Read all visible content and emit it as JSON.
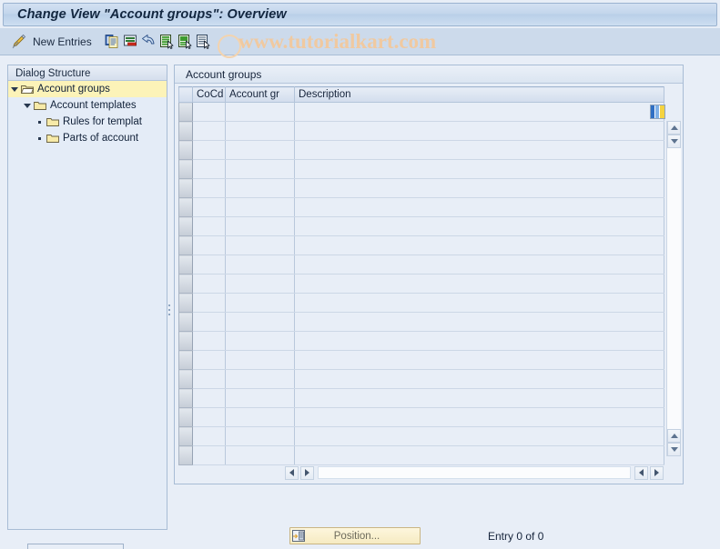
{
  "window": {
    "title": "Change View \"Account groups\": Overview"
  },
  "toolbar": {
    "edit_icon": "pencil-icon",
    "new_entries_label": "New Entries",
    "buttons": [
      {
        "name": "copy-as-button",
        "icon": "copy-document-icon"
      },
      {
        "name": "delete-button",
        "icon": "delete-document-icon"
      },
      {
        "name": "undo-button",
        "icon": "undo-arrow-icon"
      },
      {
        "name": "select-all-button",
        "icon": "document-select-icon"
      },
      {
        "name": "deselect-all-button",
        "icon": "document-deselect-icon"
      },
      {
        "name": "variant-button",
        "icon": "document-list-icon"
      }
    ]
  },
  "watermark": {
    "text": "www.tutorialkart.com"
  },
  "dialog_structure": {
    "header": "Dialog Structure",
    "items": [
      {
        "label": "Account groups",
        "level": 0,
        "expanded": true,
        "selected": true,
        "icon": "open-folder-icon"
      },
      {
        "label": "Account templates",
        "level": 1,
        "expanded": true,
        "selected": false,
        "icon": "folder-icon"
      },
      {
        "label": "Rules for templat",
        "level": 2,
        "expanded": false,
        "selected": false,
        "icon": "folder-icon"
      },
      {
        "label": "Parts of account",
        "level": 2,
        "expanded": false,
        "selected": false,
        "icon": "folder-icon"
      }
    ]
  },
  "main": {
    "section_title": "Account groups",
    "table": {
      "columns": [
        "CoCd",
        "Account gr",
        "Description"
      ],
      "rows": [],
      "empty_row_count": 19,
      "config_icon": "table-settings-icon"
    },
    "scrollbars": {
      "vertical_up_icon": "arrow-up-icon",
      "vertical_down_icon": "arrow-down-icon",
      "horizontal_left_icon": "arrow-left-icon",
      "horizontal_right_icon": "arrow-right-icon"
    }
  },
  "footer": {
    "position_button_label": "Position...",
    "position_button_icon": "position-icon",
    "entry_status": "Entry 0 of 0"
  },
  "colors": {
    "title_bar": "#c3d6ec",
    "toolbar_bg": "#ccdaeb",
    "panel_bg": "#e8eef7",
    "selected_row": "#fcf3b8",
    "watermark": "#f0c9a0",
    "button_yellow": "#f6ebc2"
  }
}
